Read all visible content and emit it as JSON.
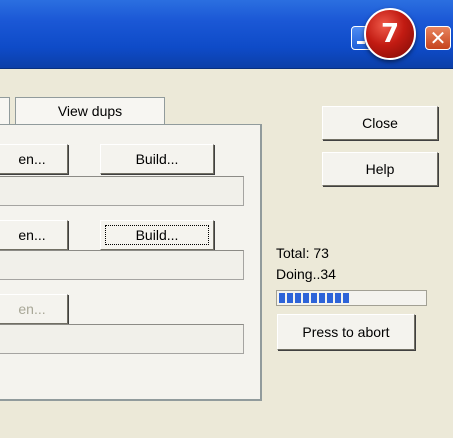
{
  "badge": {
    "number": "7"
  },
  "titlebar": {
    "close_glyph": "✕"
  },
  "tabs": {
    "view_dups": "View dups"
  },
  "panel": {
    "row1_open": "en...",
    "row1_build": "Build...",
    "row2_open": "en...",
    "row2_build": "Build...",
    "row3_open": "en..."
  },
  "side": {
    "close": "Close",
    "help": "Help",
    "total": "Total:  73",
    "doing": "Doing..34",
    "abort": "Press to abort"
  },
  "progress": {
    "value": 0.52
  },
  "colors": {
    "title_bar": "#0e4bc8",
    "progress": "#2d63d8",
    "badge": "#c21b12"
  }
}
